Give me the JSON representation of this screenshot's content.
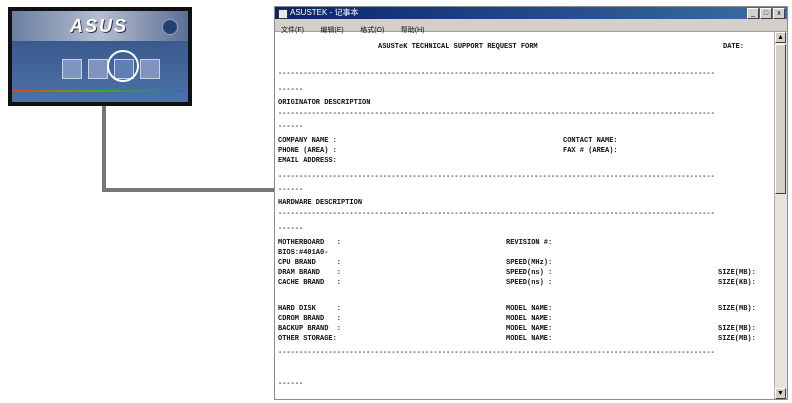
{
  "thumbnail": {
    "logo": "ASUS"
  },
  "window": {
    "title": "ASUSTEK - 记事本",
    "minimize_glyph": "_",
    "maximize_glyph": "□",
    "close_glyph": "x",
    "menus": [
      "文件(F)",
      "编辑(E)",
      "格式(O)",
      "帮助(H)"
    ]
  },
  "form": {
    "header": "ASUSTeK TECHNICAL SUPPORT REQUEST FORM",
    "date_label": "DATE:",
    "short_rule": "------",
    "long_rule": "--------------------------------------------------------------------------------------------------------",
    "originator": {
      "heading": "ORIGINATOR DESCRIPTION",
      "company": "COMPANY NAME :",
      "contact": "CONTACT NAME:",
      "phone": "PHONE (AREA) :",
      "fax": "FAX # (AREA):",
      "email": "EMAIL ADDRESS:"
    },
    "hardware": {
      "heading": "HARDWARE DESCRIPTION",
      "motherboard": "MOTHERBOARD   :",
      "revision": "REVISION #:",
      "bios": "BIOS:#401A0-",
      "cpu": "CPU BRAND     :",
      "cpu_speed": "SPEED(MHz):",
      "dram": "DRAM BRAND    :",
      "dram_speed": "SPEED(ns) :",
      "dram_size": "SIZE(MB):",
      "cache": "CACHE BRAND   :",
      "cache_speed": "SPEED(ns) :",
      "cache_size": "SIZE(KB):",
      "hdd": "HARD DISK     :",
      "hdd_model": "MODEL NAME:",
      "hdd_size": "SIZE(MB):",
      "cdrom": "CDROM BRAND   :",
      "cdrom_model": "MODEL NAME:",
      "backup": "BACKUP BRAND  :",
      "backup_model": "MODEL NAME:",
      "backup_size": "SIZE(MB):",
      "other": "OTHER STORAGE:",
      "other_model": "MODEL NAME:",
      "other_size": "SIZE(MB):"
    }
  }
}
